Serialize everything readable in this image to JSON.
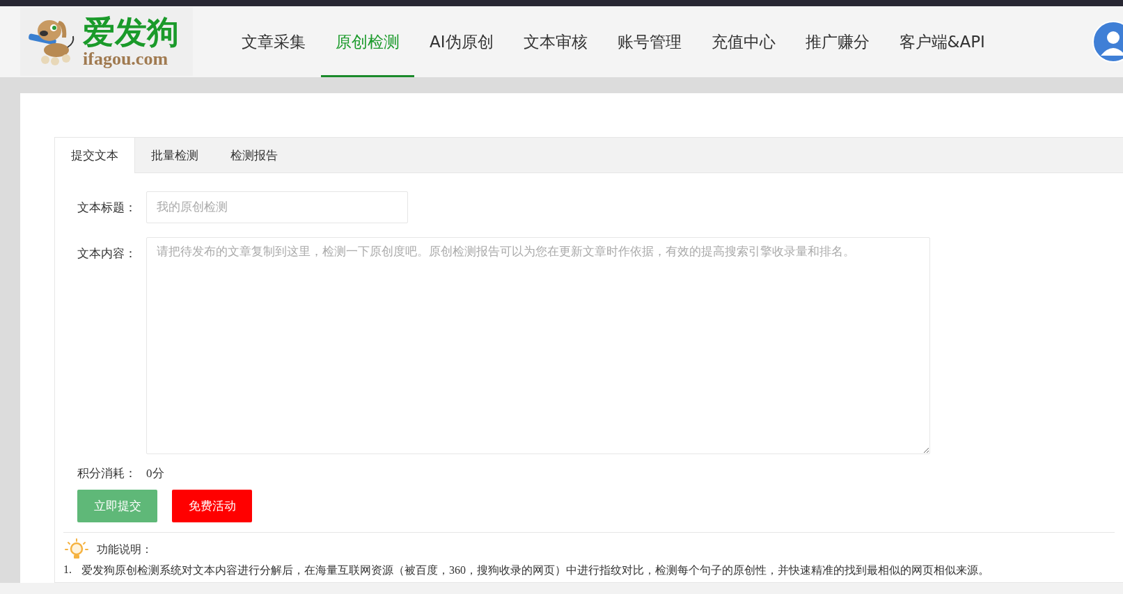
{
  "logo": {
    "name": "爱发狗",
    "domain": "ifagou.com"
  },
  "nav": [
    {
      "label": "文章采集",
      "selected": false
    },
    {
      "label": "原创检测",
      "selected": true
    },
    {
      "label": "AI伪原创",
      "selected": false
    },
    {
      "label": "文本审核",
      "selected": false
    },
    {
      "label": "账号管理",
      "selected": false
    },
    {
      "label": "充值中心",
      "selected": false
    },
    {
      "label": "推广赚分",
      "selected": false
    },
    {
      "label": "客户端&API",
      "selected": false
    }
  ],
  "tabs": [
    {
      "label": "提交文本",
      "selected": true
    },
    {
      "label": "批量检测",
      "selected": false
    },
    {
      "label": "检测报告",
      "selected": false
    }
  ],
  "form": {
    "title_label": "文本标题：",
    "title_placeholder": "我的原创检测",
    "content_label": "文本内容：",
    "content_placeholder": "请把待发布的文章复制到这里，检测一下原创度吧。原创检测报告可以为您在更新文章时作依据，有效的提高搜索引擎收录量和排名。",
    "cost_label": "积分消耗：",
    "cost_value": "0分"
  },
  "buttons": [
    {
      "label": "立即提交",
      "kind": "submit"
    },
    {
      "label": "免费活动",
      "kind": "promo"
    }
  ],
  "help": {
    "title": "功能说明：",
    "items": [
      {
        "number": "1.",
        "text": "爱发狗原创检测系统对文本内容进行分解后，在海量互联网资源（被百度，360，搜狗收录的网页）中进行指纹对比，检测每个句子的原创性，并快速精准的找到最相似的网页相似来源。"
      }
    ]
  }
}
